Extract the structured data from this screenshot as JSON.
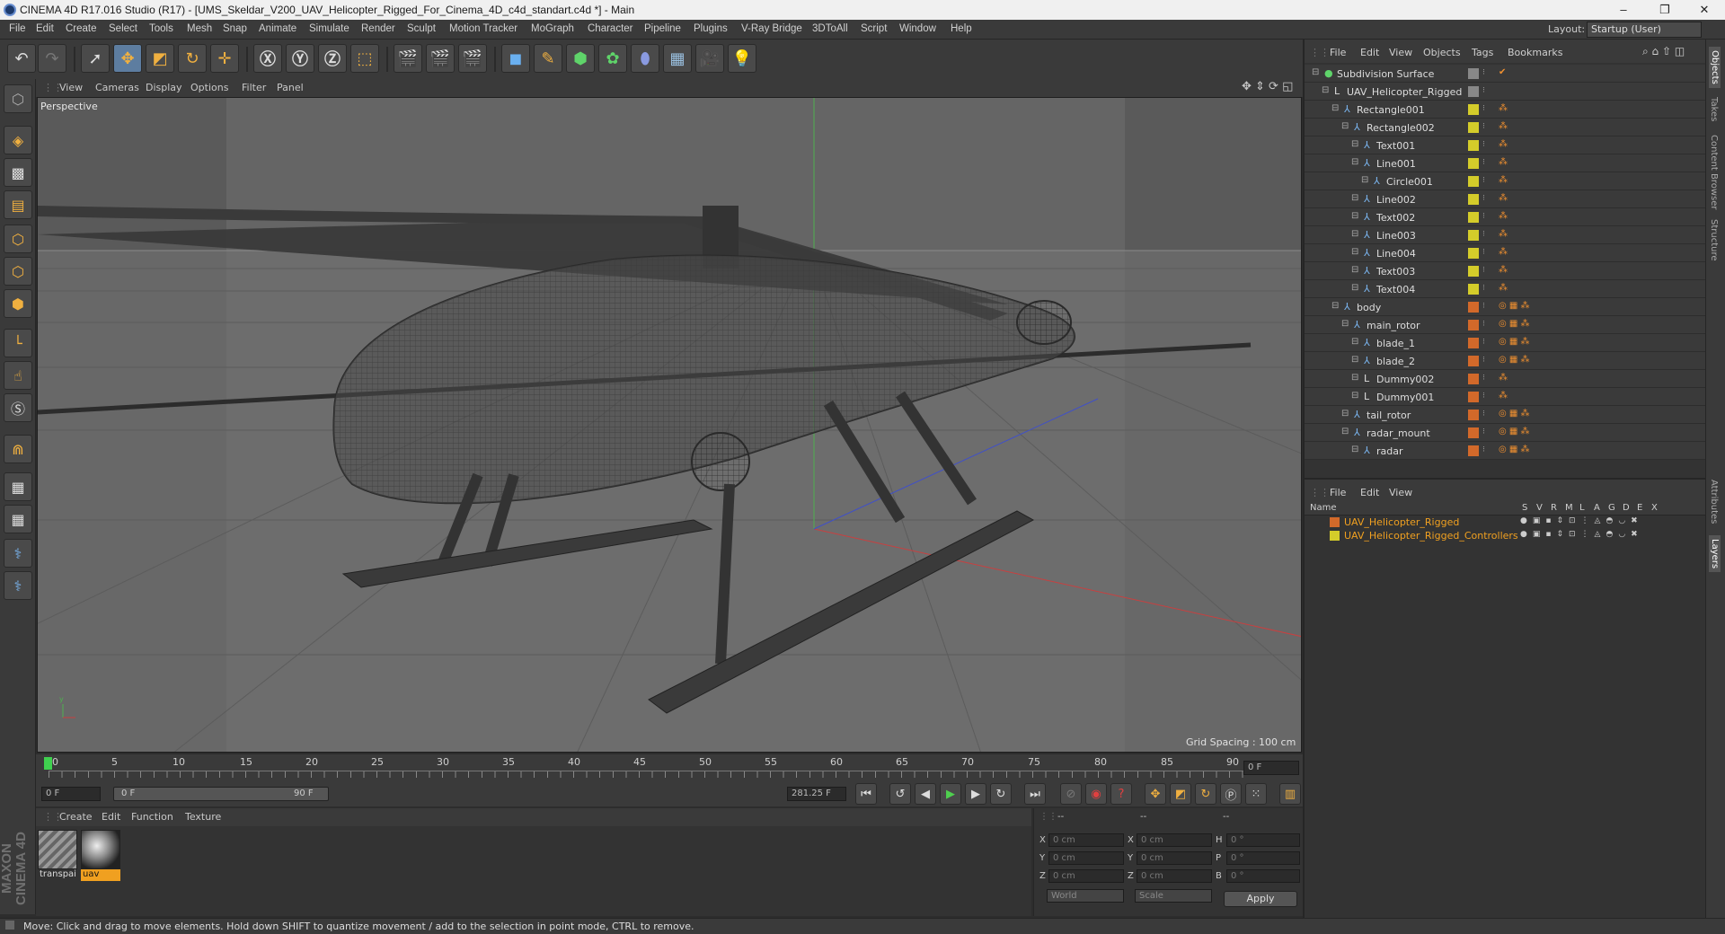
{
  "window": {
    "title": "CINEMA 4D R17.016 Studio (R17) - [UMS_Skeldar_V200_UAV_Helicopter_Rigged_For_Cinema_4D_c4d_standart.c4d *] - Main",
    "minimize": "–",
    "maximize": "❐",
    "close": "✕"
  },
  "menu": [
    "File",
    "Edit",
    "Create",
    "Select",
    "Tools",
    "Mesh",
    "Snap",
    "Animate",
    "Simulate",
    "Render",
    "Sculpt",
    "Motion Tracker",
    "MoGraph",
    "Character",
    "Pipeline",
    "Plugins",
    "V-Ray Bridge",
    "3DToAll",
    "Script",
    "Window",
    "Help"
  ],
  "layout": {
    "label": "Layout:",
    "value": "Startup (User)"
  },
  "viewport": {
    "menu": [
      "View",
      "Cameras",
      "Display",
      "Options",
      "Filter",
      "Panel"
    ],
    "label": "Perspective",
    "grid_spacing": "Grid Spacing : 100 cm"
  },
  "timeline": {
    "ticks": [
      "0",
      "5",
      "10",
      "15",
      "20",
      "25",
      "30",
      "35",
      "40",
      "45",
      "50",
      "55",
      "60",
      "65",
      "70",
      "75",
      "80",
      "85",
      "90"
    ],
    "current_frame": "0 F",
    "start_field": "0 F",
    "range_start": "0 F",
    "range_end": "90 F",
    "end_field": "281.25 F"
  },
  "material_panel": {
    "menu": [
      "Create",
      "Edit",
      "Function",
      "Texture"
    ],
    "materials": [
      {
        "name": "transpai"
      },
      {
        "name": "uav"
      }
    ]
  },
  "coords": {
    "header": [
      "--",
      "--",
      "--"
    ],
    "rows": [
      {
        "a": "X",
        "av": "0 cm",
        "b": "X",
        "bv": "0 cm",
        "c": "H",
        "cv": "0 °"
      },
      {
        "a": "Y",
        "av": "0 cm",
        "b": "Y",
        "bv": "0 cm",
        "c": "P",
        "cv": "0 °"
      },
      {
        "a": "Z",
        "av": "0 cm",
        "b": "Z",
        "bv": "0 cm",
        "c": "B",
        "cv": "0 °"
      }
    ],
    "mode": "World",
    "scale": "Scale",
    "apply": "Apply"
  },
  "object_manager": {
    "menu": [
      "File",
      "Edit",
      "View",
      "Objects",
      "Tags",
      "Bookmarks"
    ],
    "objects": [
      {
        "name": "Subdivision Surface",
        "depth": 0,
        "icon": "subdivision-icon",
        "layer": "#888888"
      },
      {
        "name": "UAV_Helicopter_Rigged",
        "depth": 1,
        "icon": "null-icon",
        "layer": "#888888"
      },
      {
        "name": "Rectangle001",
        "depth": 2,
        "icon": "spline-icon",
        "layer": "#d4cc2a"
      },
      {
        "name": "Rectangle002",
        "depth": 3,
        "icon": "spline-icon",
        "layer": "#d4cc2a"
      },
      {
        "name": "Text001",
        "depth": 4,
        "icon": "spline-icon",
        "layer": "#d4cc2a"
      },
      {
        "name": "Line001",
        "depth": 4,
        "icon": "spline-icon",
        "layer": "#d4cc2a"
      },
      {
        "name": "Circle001",
        "depth": 5,
        "icon": "spline-icon",
        "layer": "#d4cc2a"
      },
      {
        "name": "Line002",
        "depth": 4,
        "icon": "spline-icon",
        "layer": "#d4cc2a"
      },
      {
        "name": "Text002",
        "depth": 4,
        "icon": "spline-icon",
        "layer": "#d4cc2a"
      },
      {
        "name": "Line003",
        "depth": 4,
        "icon": "spline-icon",
        "layer": "#d4cc2a"
      },
      {
        "name": "Line004",
        "depth": 4,
        "icon": "spline-icon",
        "layer": "#d4cc2a"
      },
      {
        "name": "Text003",
        "depth": 4,
        "icon": "spline-icon",
        "layer": "#d4cc2a"
      },
      {
        "name": "Text004",
        "depth": 4,
        "icon": "spline-icon",
        "layer": "#d4cc2a"
      },
      {
        "name": "body",
        "depth": 2,
        "icon": "polygon-icon",
        "layer": "#d2692a"
      },
      {
        "name": "main_rotor",
        "depth": 3,
        "icon": "polygon-icon",
        "layer": "#d2692a"
      },
      {
        "name": "blade_1",
        "depth": 4,
        "icon": "polygon-icon",
        "layer": "#d2692a"
      },
      {
        "name": "blade_2",
        "depth": 4,
        "icon": "polygon-icon",
        "layer": "#d2692a"
      },
      {
        "name": "Dummy002",
        "depth": 4,
        "icon": "null-icon",
        "layer": "#d2692a"
      },
      {
        "name": "Dummy001",
        "depth": 4,
        "icon": "null-icon",
        "layer": "#d2692a"
      },
      {
        "name": "tail_rotor",
        "depth": 3,
        "icon": "polygon-icon",
        "layer": "#d2692a"
      },
      {
        "name": "radar_mount",
        "depth": 3,
        "icon": "polygon-icon",
        "layer": "#d2692a"
      },
      {
        "name": "radar",
        "depth": 4,
        "icon": "polygon-icon",
        "layer": "#d2692a"
      }
    ]
  },
  "layer_manager": {
    "menu": [
      "File",
      "Edit",
      "View"
    ],
    "columns": [
      "Name",
      "S",
      "V",
      "R",
      "M",
      "L",
      "A",
      "G",
      "D",
      "E",
      "X"
    ],
    "layers": [
      {
        "name": "UAV_Helicopter_Rigged",
        "color": "#d2692a"
      },
      {
        "name": "UAV_Helicopter_Rigged_Controllers",
        "color": "#d4cc2a"
      }
    ]
  },
  "right_tabs": [
    "Objects",
    "Takes",
    "Content Browser",
    "Structure",
    "Attributes",
    "Layers"
  ],
  "status": "Move: Click and drag to move elements. Hold down SHIFT to quantize movement / add to the selection in point mode, CTRL to remove.",
  "branding": "MAXON CINEMA 4D"
}
